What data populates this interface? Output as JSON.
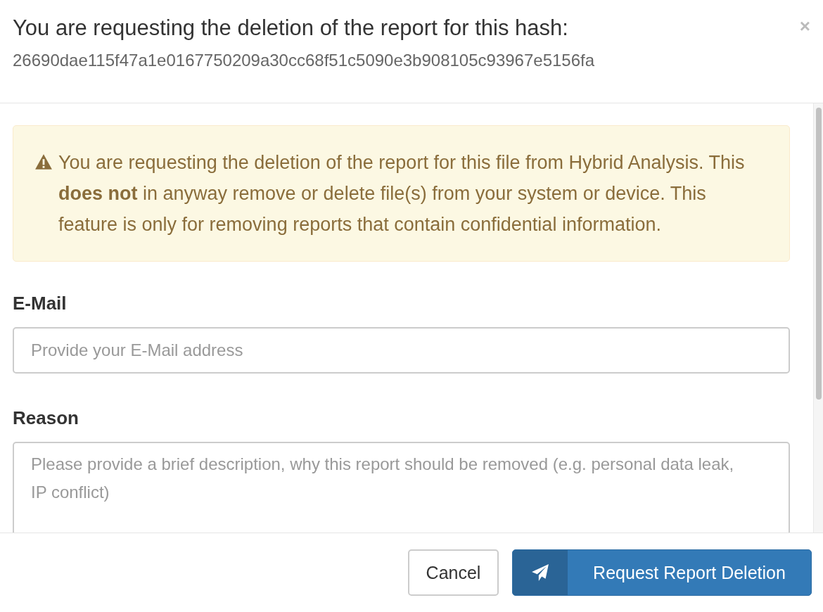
{
  "dialog": {
    "title": "You are requesting the deletion of the report for this hash:",
    "hash": "26690dae115f47a1e0167750209a30cc68f51c5090e3b908105c93967e5156fa",
    "close": "×"
  },
  "alert": {
    "text": "You are requesting the deletion of the report for this file from Hybrid Analysis. This **does not** in anyway remove or delete file(s) from your system or device. This feature is only for removing reports that contain confidential information."
  },
  "fields": [
    {
      "label": "E-Mail",
      "kind": "input",
      "placeholder": "Provide your E-Mail address"
    },
    {
      "label": "Reason",
      "kind": "textarea",
      "placeholder": "Please provide a brief description, why this report should be removed (e.g. personal data leak, IP conflict)"
    }
  ],
  "buttons": [
    {
      "label": "Cancel",
      "kind": "default"
    },
    {
      "label": "Request Report Deletion",
      "kind": "primary"
    }
  ]
}
